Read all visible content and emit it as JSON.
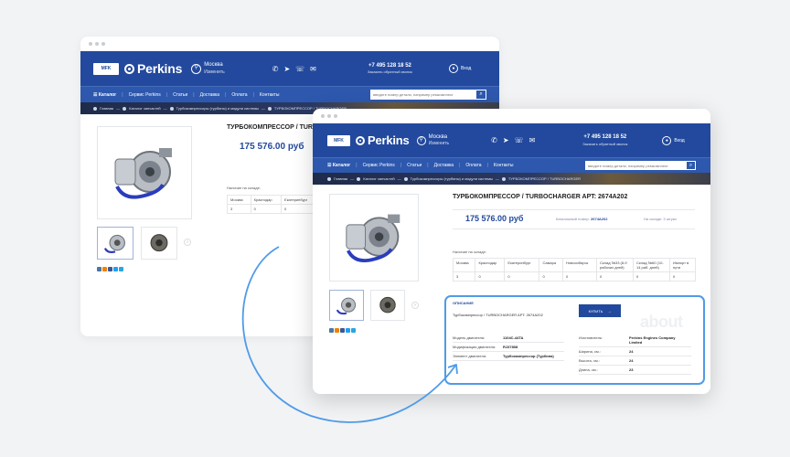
{
  "brand": {
    "small_logo": "MFK",
    "name": "Perkins",
    "city": "Москва",
    "city_change": "Изменить"
  },
  "header": {
    "phone": "+7 495 128 18 52",
    "callback": "Заказать обратный звонок",
    "login": "Вход"
  },
  "nav": {
    "catalog": "Каталог",
    "items": [
      "Сервис Perkins",
      "Статьи",
      "Доставка",
      "Оплата",
      "Контакты"
    ]
  },
  "search": {
    "placeholder": "введите номер детали, например ремкомплект"
  },
  "breadcrumbs": {
    "home": "Главная",
    "catalog": "Каталог запчастей",
    "category": "Турбокомпрессоры (турбины) и модули системы",
    "current": "ТУРБОКОМПРЕССОР / TURBOCHARGER"
  },
  "product": {
    "title_full": "ТУРБОКОМПРЕССОР / TURBOCHARGER APT: 2674A202",
    "title_short": "ТУРБОКОМПРЕССОР / TUR",
    "price": "175 576.00 руб",
    "catalog_label": "Каталожный номер:",
    "catalog_number": "2674A202",
    "in_stock_label": "На складе:",
    "in_stock_value": "3 штуки",
    "availability_label": "Наличие на складе:"
  },
  "stock_table": {
    "headers": [
      "Москва",
      "Краснодар",
      "Екатеринбург",
      "Самара",
      "Новосибирск",
      "Склад №33 (8-9 рабочих дней)",
      "Склад №60 (10-14 раб. дней)",
      "Импорт в пути"
    ],
    "values": [
      "3",
      "0",
      "0",
      "0",
      "0",
      "0",
      "0",
      "0"
    ]
  },
  "back_stock": {
    "headers": [
      "Москва",
      "Краснодар",
      "Екатеринбург"
    ],
    "values": [
      "3",
      "0",
      "0"
    ]
  },
  "description": {
    "heading": "ОПИСАНИЕ",
    "text": "Турбокомпрессор / TURBOCHARGER APT: 2674A202",
    "buy": "КУПИТЬ",
    "watermark": "about"
  },
  "specs_left": [
    {
      "k": "Модель двигателя:",
      "v": "1104C-44TA"
    },
    {
      "k": "Модификация двигателя:",
      "v": "RJ37808"
    },
    {
      "k": "Элемент двигателя:",
      "v": "Турбокомпрессор (Турбина)"
    }
  ],
  "specs_right": [
    {
      "k": "Изготовитель:",
      "v": "Perkins Engines Company Limited"
    },
    {
      "k": "Ширина, см.:",
      "v": "24"
    },
    {
      "k": "Высота, см.:",
      "v": "24"
    },
    {
      "k": "Длина, см.:",
      "v": "23"
    }
  ],
  "icons": [
    "pin-icon",
    "whatsapp-icon",
    "telegram-icon",
    "viber-icon",
    "mail-icon",
    "user-icon",
    "search-icon",
    "arrow-right-icon"
  ],
  "colors": {
    "brand_blue": "#22499d",
    "highlight": "#4f9be8",
    "background": "#f2f3f5"
  }
}
